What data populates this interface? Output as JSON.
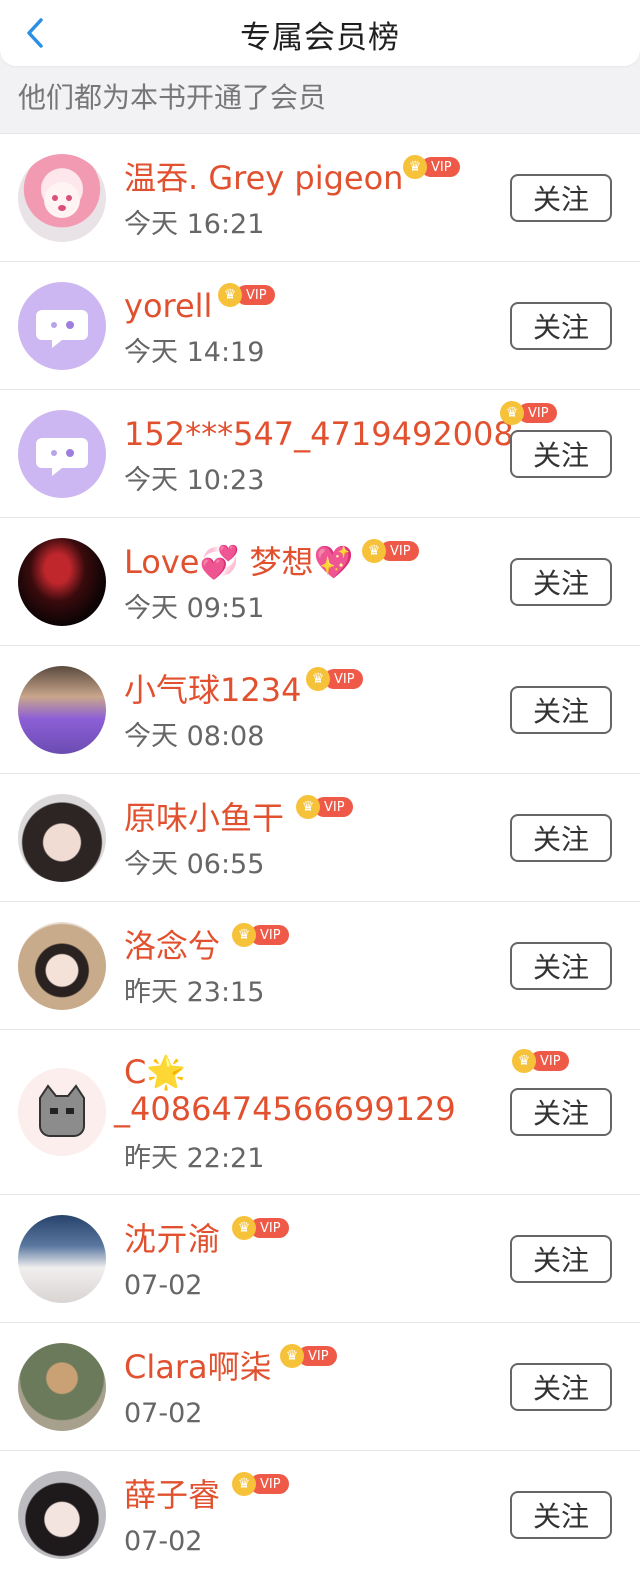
{
  "header": {
    "title": "专属会员榜",
    "back_icon": "chevron-left-icon"
  },
  "subtitle": "他们都为本书开通了会员",
  "vip_label": "VIP",
  "follow_label": "关注",
  "rows": [
    {
      "name": "温吞. Grey pigeon",
      "time": "今天 16:21"
    },
    {
      "name": "yorell",
      "time": "今天 14:19"
    },
    {
      "name": "152***547_4719492008",
      "time": "今天 10:23"
    },
    {
      "name": "Love💞 梦想💖",
      "time": "今天 09:51"
    },
    {
      "name": "小气球1234",
      "time": "今天 08:08"
    },
    {
      "name": "原味小鱼干",
      "time": "今天 06:55"
    },
    {
      "name": "洛念兮",
      "time": "昨天 23:15"
    },
    {
      "name_line1": "C🌟",
      "name_line2": "_4086474566699129",
      "time": "昨天 22:21"
    },
    {
      "name": "沈亓渝",
      "time": "07-02"
    },
    {
      "name": "Clara啊柒",
      "time": "07-02"
    },
    {
      "name": "薛子睿",
      "time": "07-02"
    }
  ]
}
